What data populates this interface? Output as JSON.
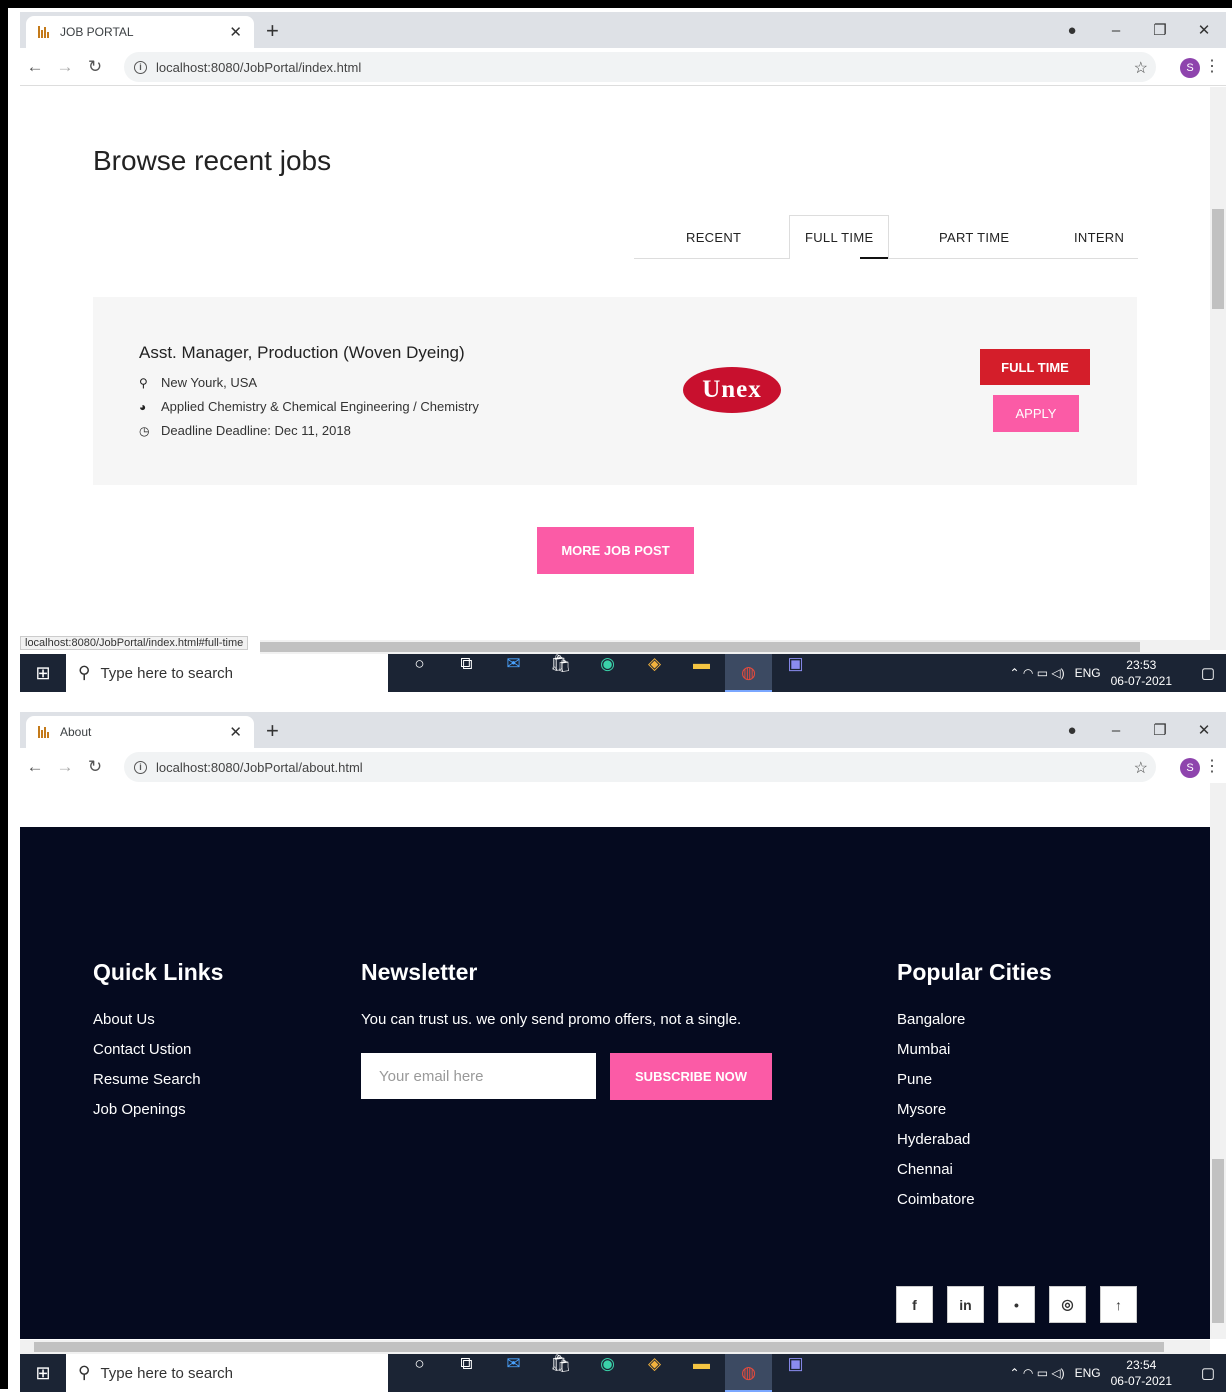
{
  "shot1": {
    "tab_title": "JOB PORTAL",
    "url": "localhost:8080/JobPortal/index.html",
    "profile_initial": "S",
    "heading": "Browse recent jobs",
    "tabs": [
      "RECENT",
      "FULL TIME",
      "PART TIME",
      "INTERN"
    ],
    "active_tab": "FULL TIME",
    "job": {
      "title": "Asst. Manager, Production (Woven Dyeing)",
      "location": "New Yourk, USA",
      "category": "Applied Chemistry & Chemical Engineering / Chemistry",
      "deadline": "Deadline Deadline: Dec 11, 2018",
      "company_logo_text": "Unex",
      "type_label": "FULL TIME",
      "apply_label": "APPLY"
    },
    "more_label": "MORE JOB POST",
    "status_url": "localhost:8080/JobPortal/index.html#full-time",
    "taskbar": {
      "search_placeholder": "Type here to search",
      "lang": "ENG",
      "time": "23:53",
      "date": "06-07-2021"
    }
  },
  "shot2": {
    "tab_title": "About",
    "url": "localhost:8080/JobPortal/about.html",
    "profile_initial": "S",
    "quick_links": {
      "title": "Quick Links",
      "items": [
        "About Us",
        "Contact Ustion",
        "Resume Search",
        "Job Openings"
      ]
    },
    "newsletter": {
      "title": "Newsletter",
      "text": "You can trust us. we only send promo offers, not a single.",
      "email_placeholder": "Your email here",
      "subscribe_label": "SUBSCRIBE NOW"
    },
    "popular_cities": {
      "title": "Popular Cities",
      "items": [
        "Bangalore",
        "Mumbai",
        "Pune",
        "Mysore",
        "Hyderabad",
        "Chennai",
        "Coimbatore"
      ]
    },
    "social": [
      "f",
      "in",
      "•",
      "◎",
      "↑"
    ],
    "taskbar": {
      "search_placeholder": "Type here to search",
      "lang": "ENG",
      "time": "23:54",
      "date": "06-07-2021"
    }
  },
  "colors": {
    "accent_pink": "#fb5ba6",
    "full_time_red": "#d41e2a",
    "footer_bg": "#050a1f",
    "logo_red": "#c8102e"
  }
}
